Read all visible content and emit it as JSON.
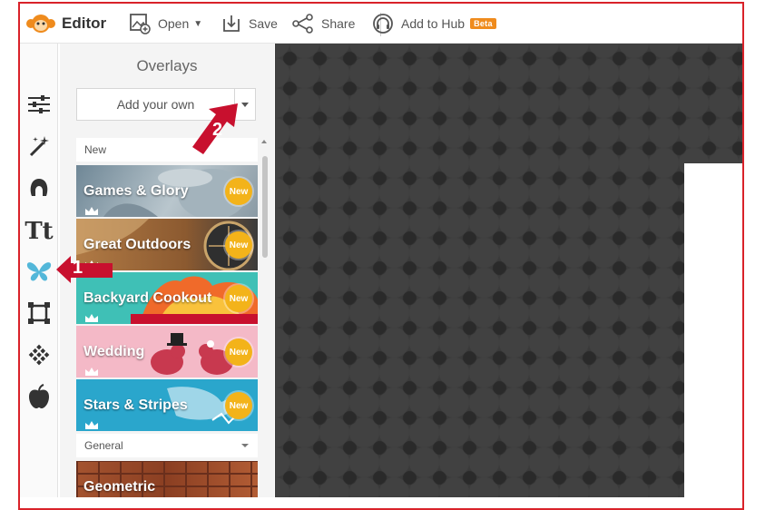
{
  "topbar": {
    "brand": "Editor",
    "open_label": "Open",
    "save_label": "Save",
    "share_label": "Share",
    "hub_label": "Add to Hub",
    "beta_badge": "Beta"
  },
  "tools": [
    {
      "name": "adjustments-icon"
    },
    {
      "name": "effects-wand-icon"
    },
    {
      "name": "touch-up-icon"
    },
    {
      "name": "text-icon",
      "glyph": "Tt"
    },
    {
      "name": "overlays-butterfly-icon"
    },
    {
      "name": "frames-icon"
    },
    {
      "name": "textures-icon"
    },
    {
      "name": "themes-apple-icon"
    }
  ],
  "panel": {
    "title": "Overlays",
    "add_button": "Add your own",
    "sections": [
      {
        "label": "New",
        "items": [
          {
            "label": "Games & Glory",
            "badge": "New",
            "bg": "#8ea0ab"
          },
          {
            "label": "Great Outdoors",
            "badge": "New",
            "bg": "#a0693c"
          },
          {
            "label": "Backyard Cookout",
            "badge": "New",
            "bg": "#3fc0b6"
          },
          {
            "label": "Wedding",
            "badge": "New",
            "bg": "#f4b9c7"
          },
          {
            "label": "Stars & Stripes",
            "badge": "New",
            "bg": "#2aa6cc"
          }
        ]
      },
      {
        "label": "General",
        "items": [
          {
            "label": "Geometric",
            "bg": "#9c4a2c"
          }
        ]
      }
    ]
  },
  "callouts": [
    {
      "number": "1"
    },
    {
      "number": "2"
    }
  ],
  "colors": {
    "accent_red": "#d9222a",
    "brand_orange": "#ef8b1d",
    "badge_yellow": "#f3b31a",
    "butterfly_blue": "#53b7d9",
    "canvas_dark": "#3a3a3a"
  }
}
